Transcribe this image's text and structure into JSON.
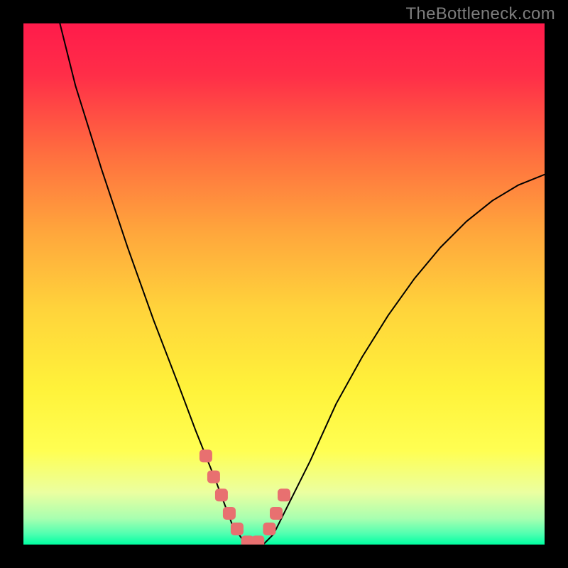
{
  "watermark": "TheBottleneck.com",
  "chart_data": {
    "type": "line",
    "title": "",
    "xlabel": "",
    "ylabel": "",
    "xlim": [
      0,
      100
    ],
    "ylim": [
      0,
      100
    ],
    "grid": false,
    "gradient_colors": {
      "top": "#ff1b4b",
      "mid_top": "#ff8a3d",
      "mid": "#ffe93d",
      "mid_bottom": "#f5ff7d",
      "bottom": "#00ff88"
    },
    "series": [
      {
        "name": "bottleneck-curve",
        "type": "line",
        "color": "#000000",
        "stroke_width": 2,
        "x": [
          7,
          10,
          15,
          20,
          25,
          30,
          33,
          35,
          37,
          38.5,
          40,
          42,
          44,
          46,
          48,
          50,
          55,
          60,
          65,
          70,
          75,
          80,
          85,
          90,
          95,
          100
        ],
        "y": [
          100,
          88,
          72,
          57,
          43,
          30,
          22,
          17,
          12,
          8,
          4,
          1,
          0,
          0,
          2,
          6,
          16,
          27,
          36,
          44,
          51,
          57,
          62,
          66,
          69,
          71
        ]
      },
      {
        "name": "marker-points",
        "type": "scatter",
        "color": "#e87070",
        "marker_size": 9,
        "x": [
          35,
          36.5,
          38,
          39.5,
          41,
          43,
          45,
          47.2,
          48.5,
          50
        ],
        "y": [
          17,
          13,
          9.5,
          6,
          3,
          0.5,
          0.5,
          3,
          6,
          9.5
        ]
      }
    ]
  }
}
